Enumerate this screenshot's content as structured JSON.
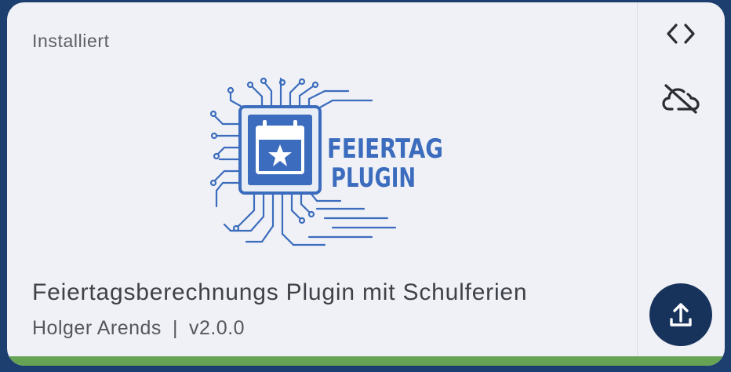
{
  "card": {
    "status": "Installiert",
    "logo": {
      "line1": "FEIERTAG",
      "line2": "PLUGIN",
      "primary_color": "#3b6cbd"
    },
    "title": "Feiertagsberechnungs Plugin mit Schulferien",
    "author": "Holger Arends",
    "separator": "|",
    "version": "v2.0.0",
    "progress_fraction": 1.0,
    "progress_color": "#66a354"
  },
  "actions": {
    "code_icon": "code-icon",
    "cloud_icon": "cloud-off-icon",
    "upload_icon": "upload-icon"
  },
  "colors": {
    "background": "#1c3f70",
    "card": "#f0f1f6",
    "fab": "#17335c"
  }
}
